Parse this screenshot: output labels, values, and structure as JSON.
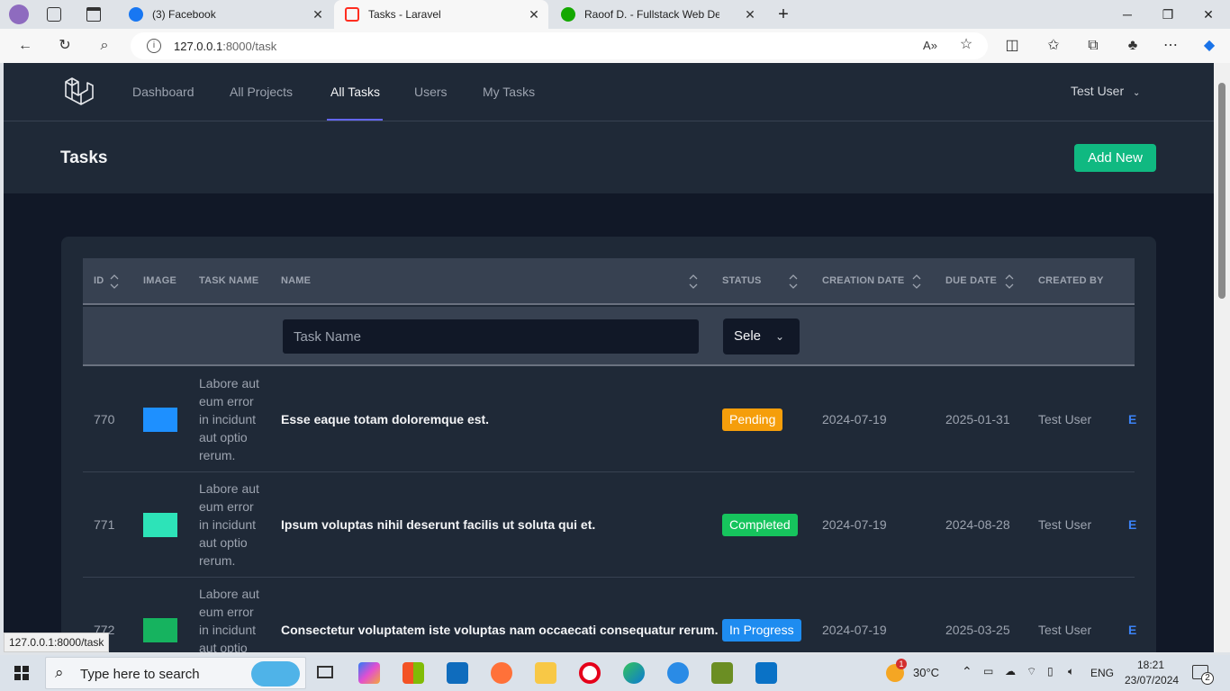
{
  "browser": {
    "tabs": [
      {
        "label": "(3) Facebook",
        "active": false,
        "favicon_color": "#1877f2"
      },
      {
        "label": "Tasks - Laravel",
        "active": true,
        "favicon_color": "#ff2d20"
      },
      {
        "label": "Raoof D. - Fullstack Web Develop",
        "active": false,
        "favicon_color": "#14a800"
      }
    ],
    "url_host": "127.0.0.1",
    "url_rest": ":8000/task",
    "status_url": "127.0.0.1:8000/task"
  },
  "nav": {
    "links": [
      "Dashboard",
      "All Projects",
      "All Tasks",
      "Users",
      "My Tasks"
    ],
    "active": "All Tasks",
    "user": "Test User"
  },
  "header": {
    "title": "Tasks",
    "add_button": "Add New"
  },
  "table": {
    "columns": [
      "ID",
      "IMAGE",
      "TASK NAME",
      "NAME",
      "STATUS",
      "CREATION DATE",
      "DUE DATE",
      "CREATED BY"
    ],
    "filter": {
      "task_name_placeholder": "Task Name",
      "status_value": "Sele"
    },
    "rows": [
      {
        "id": "770",
        "image_color": "#1e90ff",
        "description": "Labore aut eum error in incidunt aut optio rerum.",
        "name": "Esse eaque totam doloremque est.",
        "status": "Pending",
        "status_color": "#f59e0b",
        "created": "2024-07-19",
        "due": "2025-01-31",
        "created_by": "Test User",
        "action": "E"
      },
      {
        "id": "771",
        "image_color": "#2de3b8",
        "description": "Labore aut eum error in incidunt aut optio rerum.",
        "name": "Ipsum voluptas nihil deserunt facilis ut soluta qui et.",
        "status": "Completed",
        "status_color": "#16c45d",
        "created": "2024-07-19",
        "due": "2024-08-28",
        "created_by": "Test User",
        "action": "E"
      },
      {
        "id": "772",
        "image_color": "#16b35f",
        "description": "Labore aut eum error in incidunt aut optio",
        "name": "Consectetur voluptatem iste voluptas nam occaecati consequatur rerum.",
        "status": "In Progress",
        "status_color": "#1e8cf0",
        "created": "2024-07-19",
        "due": "2025-03-25",
        "created_by": "Test User",
        "action": "E"
      }
    ]
  },
  "taskbar": {
    "search_placeholder": "Type here to search",
    "weather": "30°C",
    "language": "ENG",
    "time": "18:21",
    "date": "23/07/2024",
    "notification_count": "2",
    "weather_badge": "1"
  }
}
